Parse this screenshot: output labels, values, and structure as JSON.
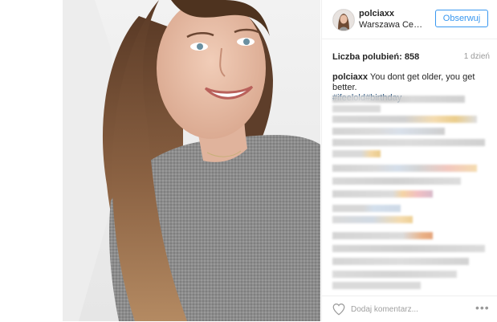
{
  "post": {
    "username": "polciaxx",
    "location": "Warszawa Centr…",
    "follow_label": "Obserwuj",
    "likes_label": "Liczba polubień: 858",
    "age": "1 dzień",
    "caption_user": "polciaxx",
    "caption_text": "You dont get older, you get better.",
    "hashtags": "#ifeelold#birthday",
    "comment_placeholder": "Dodaj komentarz...",
    "more_label": "•••"
  },
  "colors": {
    "accent": "#3897f0",
    "hashtag": "#003569",
    "border": "#efefef"
  },
  "icons": [
    "heart-icon",
    "more-options-icon"
  ]
}
